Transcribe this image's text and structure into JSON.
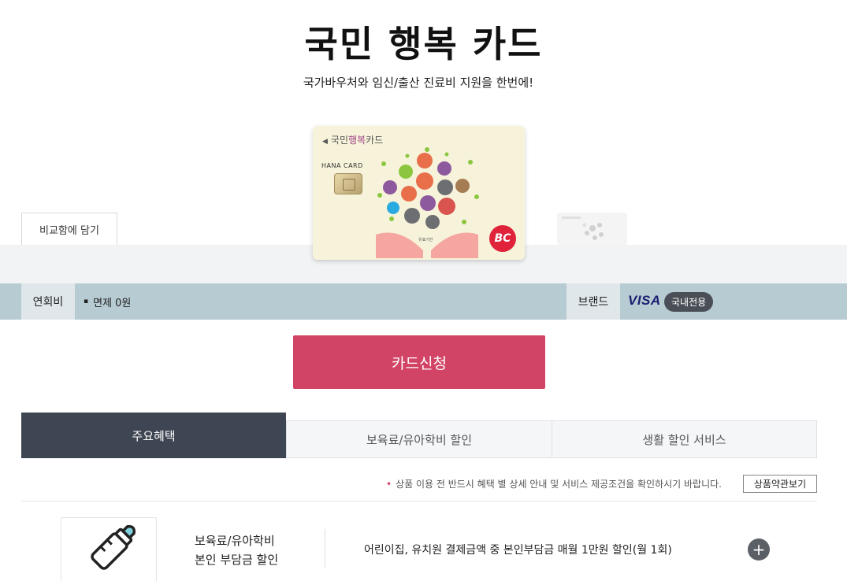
{
  "header": {
    "title": "국민 행복 카드",
    "subtitle": "국가바우처와 임신/출산 진료비 지원을 한번에!"
  },
  "compare": {
    "label": "비교함에 담기"
  },
  "card": {
    "logo_prefix": "국민",
    "logo_accent": "행복",
    "logo_suffix": "카드",
    "issuer": "HANA CARD",
    "network_logo": "BC",
    "art_caption": "유효기한"
  },
  "info": {
    "fee_label": "연회비",
    "fee_value": "면제 0원",
    "brand_label": "브랜드",
    "brand_name": "VISA",
    "brand_badge": "국내전용"
  },
  "apply": {
    "label": "카드신청"
  },
  "tabs": [
    {
      "label": "주요혜택",
      "active": true
    },
    {
      "label": "보육료/유아학비 할인",
      "active": false
    },
    {
      "label": "생활 할인 서비스",
      "active": false
    }
  ],
  "notice": {
    "text": "상품 이용 전 반드시 혜택 별 상세 안내 및 서비스 제공조건을 확인하시기 바랍니다.",
    "terms_label": "상품약관보기"
  },
  "benefits": [
    {
      "icon": "baby-bottle-icon",
      "title_line1": "보육료/유아학비",
      "title_line2": "본인 부담금 할인",
      "description": "어린이집, 유치원 결제금액 중 본인부담금 매월 1만원 할인(월 1회)"
    }
  ],
  "colors": {
    "apply_button": "#d24466",
    "active_tab": "#3f4653",
    "info_bar": "#b7cbd2",
    "visa_blue": "#1a1f71"
  }
}
